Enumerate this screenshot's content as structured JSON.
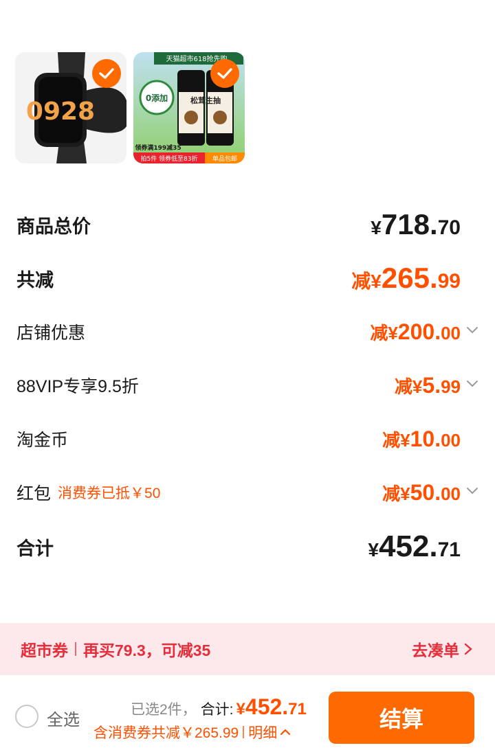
{
  "products": [
    {
      "icon": "smartwatch-image",
      "selected": true,
      "watch_time": "0928"
    },
    {
      "icon": "soy-sauce-image",
      "selected": true,
      "ad": {
        "top_banner": "天猫超市618抢先购",
        "badge": "0添加",
        "bottle_label": "松茸生抽",
        "coupon_text": "领券满199减35",
        "bottom_left": "拍5件 领券低至83折",
        "bottom_right": "单品包邮"
      }
    }
  ],
  "summary": {
    "total": {
      "label": "商品总价",
      "prefix": "¥",
      "int": "718.",
      "dec": "70"
    },
    "discount": {
      "label": "共减",
      "prefix": "减¥",
      "int": "265.",
      "dec": "99"
    },
    "shop": {
      "label": "店铺优惠",
      "prefix": "减¥",
      "int": "200.",
      "dec": "00"
    },
    "vip": {
      "label": "88VIP专享9.5折",
      "prefix": "减¥",
      "int": "5.",
      "dec": "99"
    },
    "coins": {
      "label": "淘金币",
      "prefix": "减¥",
      "int": "10.",
      "dec": "00"
    },
    "redpacket": {
      "label": "红包",
      "note": "消费券已抵￥50",
      "prefix": "减¥",
      "int": "50.",
      "dec": "00"
    },
    "sum": {
      "label": "合计",
      "prefix": "¥",
      "int": "452.",
      "dec": "71"
    }
  },
  "promo": {
    "tag": "超市券",
    "text": "再买79.3，可减35",
    "link": "去凑单"
  },
  "checkout": {
    "select_all": "全选",
    "selected": "已选2件，",
    "sum_label": "合计:",
    "prefix": "¥",
    "int": "452.",
    "dec": "71",
    "saved_text": "含消费券共减￥265.99",
    "detail": "明细",
    "pay_button": "结算"
  },
  "colors": {
    "accent": "#ff6a00",
    "discount": "#ff5000",
    "promo_bg": "#fde8ec",
    "promo_text": "#e52e3a"
  }
}
